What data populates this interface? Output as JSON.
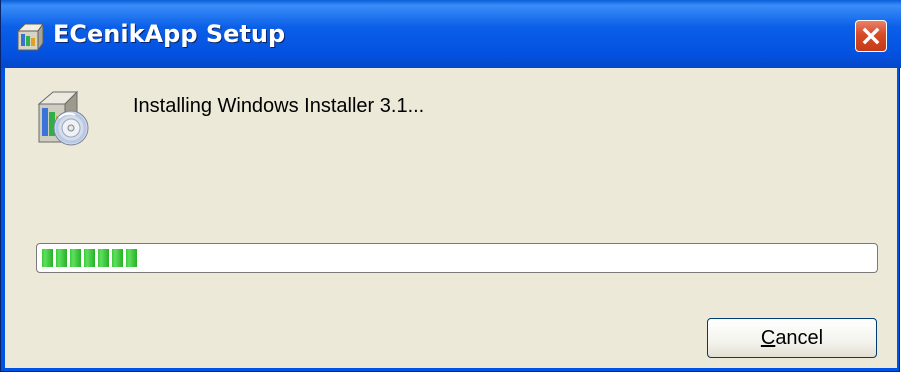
{
  "window": {
    "title": "ECenikApp Setup",
    "title_icon": "setup-box-icon",
    "close_icon": "close-icon"
  },
  "content": {
    "app_icon": "installer-disc-icon",
    "status_text": "Installing Windows Installer 3.1...",
    "progress": {
      "percent": 12,
      "style": "segmented-green"
    }
  },
  "buttons": {
    "cancel_mnemonic": "C",
    "cancel_rest": "ancel"
  },
  "colors": {
    "titlebar": "#0054e3",
    "client_bg": "#ece9d8",
    "progress_green": "#3dc93d",
    "close_red": "#d94a26"
  }
}
